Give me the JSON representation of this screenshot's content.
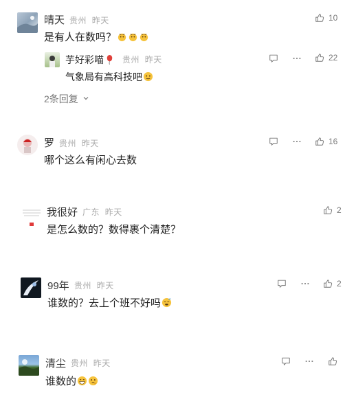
{
  "comments": [
    {
      "name": "晴天",
      "location": "贵州",
      "time": "昨天",
      "text": "是有人在数吗？",
      "likes": "10",
      "reply": {
        "name": "芋好彩喵",
        "location": "贵州",
        "time": "昨天",
        "text": "气象局有高科技吧",
        "likes": "22"
      },
      "more_replies": "2条回复"
    },
    {
      "name": "罗",
      "location": "贵州",
      "time": "昨天",
      "text": "哪个这么有闲心去数",
      "likes": "16"
    },
    {
      "name": "我很好",
      "location": "广东",
      "time": "昨天",
      "text": "是怎么数的？数得裹个清楚？",
      "likes": "2"
    },
    {
      "name": "99年",
      "location": "贵州",
      "time": "昨天",
      "text": "谁数的？去上个班不好吗",
      "likes": "2"
    },
    {
      "name": "清尘",
      "location": "贵州",
      "time": "昨天",
      "text": "谁数的",
      "likes": ""
    }
  ],
  "icons": {
    "like": "thumb-up-icon",
    "reply": "comment-icon",
    "more": "more-dots-icon",
    "expand": "chevron-down-icon"
  }
}
